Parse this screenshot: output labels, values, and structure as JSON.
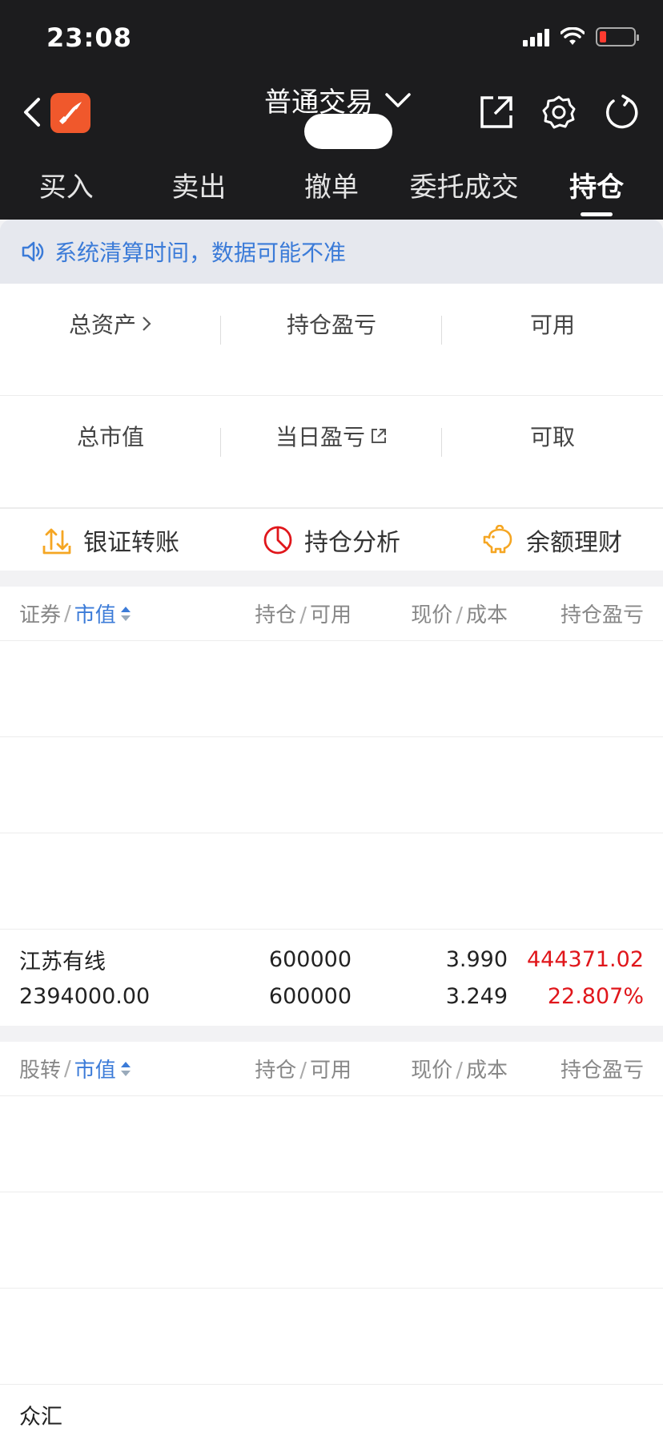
{
  "status": {
    "time": "23:08"
  },
  "nav": {
    "title": "普通交易"
  },
  "tabs": [
    "买入",
    "卖出",
    "撤单",
    "委托成交",
    "持仓"
  ],
  "notice": {
    "text": "系统清算时间，数据可能不准"
  },
  "summary": {
    "total_assets_label": "总资产",
    "position_pl_label": "持仓盈亏",
    "available_label": "可用",
    "market_value_label": "总市值",
    "day_pl_label": "当日盈亏",
    "withdrawable_label": "可取"
  },
  "actions": {
    "transfer": "银证转账",
    "analysis": "持仓分析",
    "wealth": "余额理财"
  },
  "colors": {
    "accent": "#3b7bd8",
    "red": "#e0161b",
    "brand": "#f0582c"
  },
  "securities": {
    "header": {
      "name": "证券",
      "sort": "市值",
      "hold": "持仓",
      "avail": "可用",
      "price": "现价",
      "cost": "成本",
      "pl": "持仓盈亏"
    },
    "jiangsu": {
      "name": "江苏有线",
      "market_value": "2394000.00",
      "hold": "600000",
      "avail": "600000",
      "price": "3.990",
      "cost": "3.249",
      "pl": "444371.02",
      "pl_pct": "22.807%"
    }
  },
  "transfer_section": {
    "header": {
      "name": "股转",
      "sort": "市值",
      "hold": "持仓",
      "avail": "可用",
      "price": "现价",
      "cost": "成本",
      "pl": "持仓盈亏"
    },
    "last_row_name": "众汇"
  }
}
